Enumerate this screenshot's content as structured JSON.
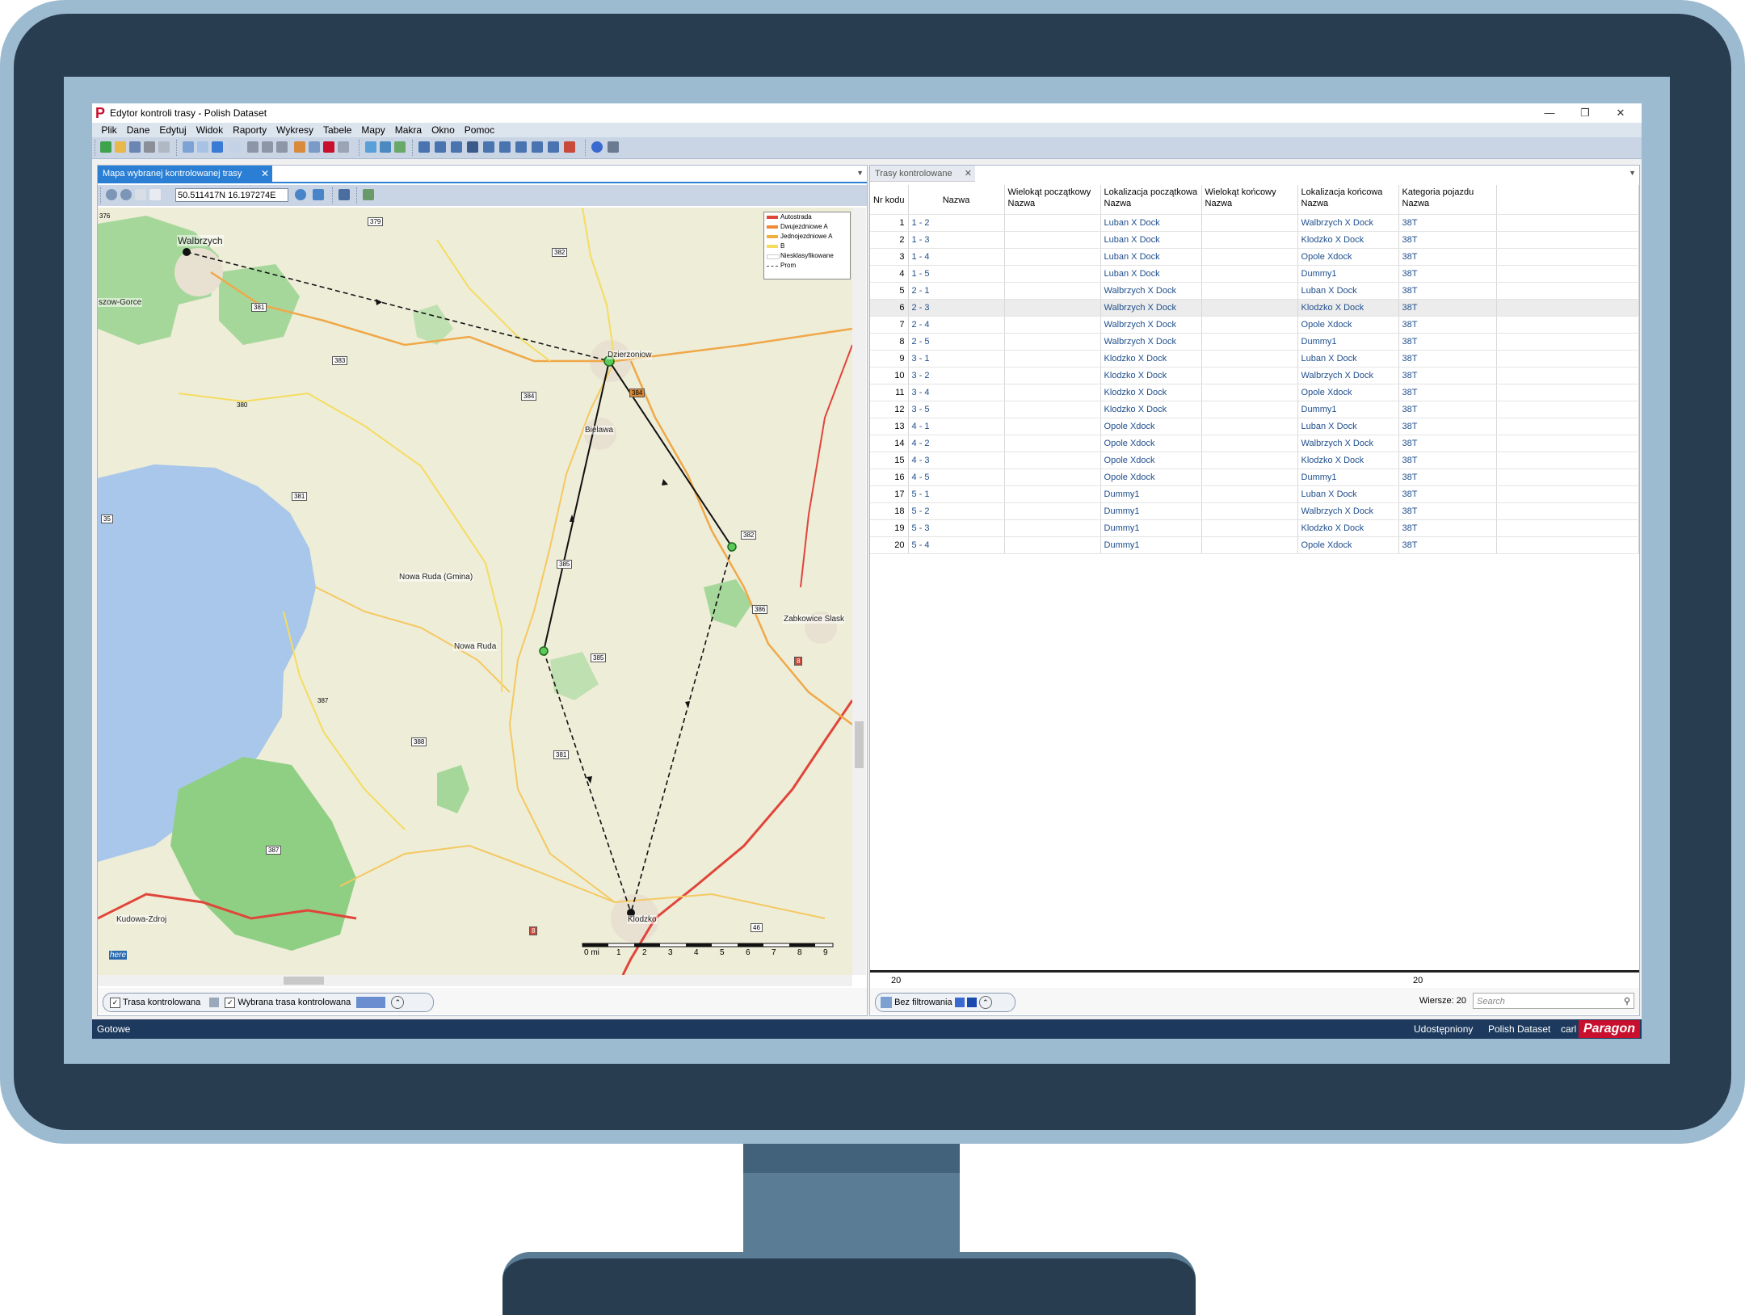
{
  "window": {
    "title": "Edytor kontroli trasy - Polish Dataset",
    "controls": [
      "—",
      "❐",
      "✕"
    ]
  },
  "menu": [
    "Plik",
    "Dane",
    "Edytuj",
    "Widok",
    "Raporty",
    "Wykresy",
    "Tabele",
    "Mapy",
    "Makra",
    "Okno",
    "Pomoc"
  ],
  "left_panel": {
    "tab_label": "Mapa wybranej kontrolowanej trasy",
    "coords": "50.511417N 16.197274E",
    "legend": [
      {
        "label": "Autostrada",
        "color": "#e0453a"
      },
      {
        "label": "Dwujezdniowe A",
        "color": "#f08a3a"
      },
      {
        "label": "Jednojezdniowe A",
        "color": "#f0b040"
      },
      {
        "label": "B",
        "color": "#f5dc60"
      },
      {
        "label": "Niesklasyfikowane",
        "color": "#ffffff"
      },
      {
        "label": "Prom",
        "color": "#666666"
      }
    ],
    "places": {
      "walbrzych": "Walbrzych",
      "szow": "szow-Gorce",
      "dzierzoniow": "Dzierzoniow",
      "bielawa": "Bielawa",
      "nowaruda_gmina": "Nowa Ruda (Gmina)",
      "nowaruda": "Nowa Ruda",
      "zabkowice": "Zabkowice Slask",
      "klodzko": "Klodzko",
      "kudowa": "Kudowa-Zdroj",
      "here": "here"
    },
    "road_labels": {
      "r376": "376",
      "r379a": "379",
      "r382a": "382",
      "r381": "381",
      "r383": "383",
      "r380": "380",
      "r384a": "384",
      "r384b": "384",
      "r381b": "381",
      "r35": "35",
      "r382b": "382",
      "r385a": "385",
      "r385b": "385",
      "r387": "387",
      "r386": "386",
      "r381c": "381",
      "r388": "388",
      "r387b": "387",
      "r46": "46",
      "r8a": "8",
      "r8b": "8"
    },
    "scale_labels": [
      "0 mi",
      "1",
      "2",
      "3",
      "4",
      "5",
      "6",
      "7",
      "8",
      "9"
    ],
    "status_pills": {
      "trasa": "Trasa kontrolowana",
      "wybrana": "Wybrana trasa kontrolowana"
    }
  },
  "right_panel": {
    "tab_label": "Trasy kontrolowane",
    "columns": {
      "nr": "Nr kodu",
      "nazwa": "Nazwa",
      "wp": "Wielokąt początkowy",
      "wp_sub": "Nazwa",
      "lp": "Lokalizacja początkowa",
      "lp_sub": "Nazwa",
      "wk": "Wielokąt końcowy",
      "wk_sub": "Nazwa",
      "lk": "Lokalizacja końcowa",
      "lk_sub": "Nazwa",
      "kp": "Kategoria pojazdu",
      "kp_sub": "Nazwa"
    },
    "rows": [
      {
        "nr": "1",
        "nazwa": "1 - 2",
        "start": "Luban X Dock",
        "end": "Walbrzych X Dock",
        "cat": "38T"
      },
      {
        "nr": "2",
        "nazwa": "1 - 3",
        "start": "Luban X Dock",
        "end": "Klodzko X Dock",
        "cat": "38T"
      },
      {
        "nr": "3",
        "nazwa": "1 - 4",
        "start": "Luban X Dock",
        "end": "Opole Xdock",
        "cat": "38T"
      },
      {
        "nr": "4",
        "nazwa": "1 - 5",
        "start": "Luban X Dock",
        "end": "Dummy1",
        "cat": "38T"
      },
      {
        "nr": "5",
        "nazwa": "2 - 1",
        "start": "Walbrzych X Dock",
        "end": "Luban X Dock",
        "cat": "38T"
      },
      {
        "nr": "6",
        "nazwa": "2 - 3",
        "start": "Walbrzych X Dock",
        "end": "Klodzko X Dock",
        "cat": "38T"
      },
      {
        "nr": "7",
        "nazwa": "2 - 4",
        "start": "Walbrzych X Dock",
        "end": "Opole Xdock",
        "cat": "38T"
      },
      {
        "nr": "8",
        "nazwa": "2 - 5",
        "start": "Walbrzych X Dock",
        "end": "Dummy1",
        "cat": "38T"
      },
      {
        "nr": "9",
        "nazwa": "3 - 1",
        "start": "Klodzko X Dock",
        "end": "Luban X Dock",
        "cat": "38T"
      },
      {
        "nr": "10",
        "nazwa": "3 - 2",
        "start": "Klodzko X Dock",
        "end": "Walbrzych X Dock",
        "cat": "38T"
      },
      {
        "nr": "11",
        "nazwa": "3 - 4",
        "start": "Klodzko X Dock",
        "end": "Opole Xdock",
        "cat": "38T"
      },
      {
        "nr": "12",
        "nazwa": "3 - 5",
        "start": "Klodzko X Dock",
        "end": "Dummy1",
        "cat": "38T"
      },
      {
        "nr": "13",
        "nazwa": "4 - 1",
        "start": "Opole Xdock",
        "end": "Luban X Dock",
        "cat": "38T"
      },
      {
        "nr": "14",
        "nazwa": "4 - 2",
        "start": "Opole Xdock",
        "end": "Walbrzych X Dock",
        "cat": "38T"
      },
      {
        "nr": "15",
        "nazwa": "4 - 3",
        "start": "Opole Xdock",
        "end": "Klodzko X Dock",
        "cat": "38T"
      },
      {
        "nr": "16",
        "nazwa": "4 - 5",
        "start": "Opole Xdock",
        "end": "Dummy1",
        "cat": "38T"
      },
      {
        "nr": "17",
        "nazwa": "5 - 1",
        "start": "Dummy1",
        "end": "Luban X Dock",
        "cat": "38T"
      },
      {
        "nr": "18",
        "nazwa": "5 - 2",
        "start": "Dummy1",
        "end": "Walbrzych X Dock",
        "cat": "38T"
      },
      {
        "nr": "19",
        "nazwa": "5 - 3",
        "start": "Dummy1",
        "end": "Klodzko X Dock",
        "cat": "38T"
      },
      {
        "nr": "20",
        "nazwa": "5 - 4",
        "start": "Dummy1",
        "end": "Opole Xdock",
        "cat": "38T"
      }
    ],
    "selected_row": 6,
    "footer_count_left": "20",
    "footer_count_right": "20",
    "filter_label": "Bez filtrowania",
    "rows_label": "Wiersze: 20",
    "search_placeholder": "Search"
  },
  "statusbar": {
    "left": "Gotowe",
    "shared": "Udostępniony",
    "dataset": "Polish Dataset",
    "user": "carl",
    "brand": "Paragon"
  }
}
